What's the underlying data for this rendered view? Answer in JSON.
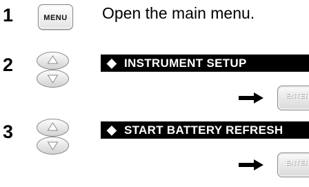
{
  "steps": [
    {
      "number": "1",
      "key_label": "MENU",
      "instruction": "Open the main menu."
    },
    {
      "number": "2",
      "key": "up-down-arrow-keys",
      "menu_item": "INSTRUMENT SETUP",
      "marker": "◆",
      "confirm_icon": "right-arrow-icon",
      "confirm_key_label": "ENTER"
    },
    {
      "number": "3",
      "key": "up-down-arrow-keys",
      "menu_item": "START BATTERY REFRESH",
      "marker": "◆",
      "confirm_icon": "right-arrow-icon",
      "confirm_key_label": "ENTER"
    }
  ],
  "colors": {
    "bar_background": "#000000",
    "bar_text": "#ffffff",
    "key_face": "#e3e3e3",
    "key_border": "#8a8a8a"
  }
}
